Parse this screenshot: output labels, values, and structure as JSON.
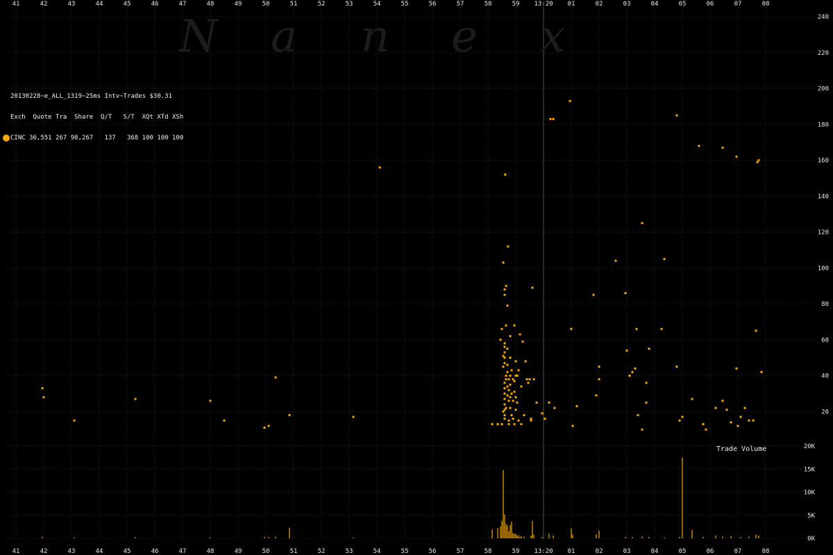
{
  "watermark": "Nanex",
  "header": {
    "title_line": "20130228~e_ALL_1319~25ms Intv~Trades $30.31",
    "columns_line": "Exch  Quote Tra  Share  Q/T   S/T  XQt XTd XSh",
    "data_line": "CINC 36,551 267 98,267   137   368 100 100 100"
  },
  "volume_label": "Trade Volume",
  "colors": {
    "marker": "#f7a800",
    "background": "#000000",
    "grid": "#2a2a2a",
    "text": "#e8e8e8"
  },
  "chart_data": [
    {
      "type": "scatter",
      "title": "",
      "xlabel": "",
      "ylabel": "",
      "x_ticks": [
        "41",
        "42",
        "43",
        "44",
        "45",
        "46",
        "47",
        "48",
        "49",
        "50",
        "51",
        "52",
        "53",
        "54",
        "55",
        "56",
        "57",
        "58",
        "59",
        "13:20",
        "01",
        "02",
        "03",
        "04",
        "05",
        "06",
        "07",
        "08"
      ],
      "ylim": [
        0,
        240
      ],
      "y_ticks": [
        20,
        40,
        60,
        80,
        100,
        120,
        140,
        160,
        180,
        200,
        220,
        240
      ],
      "grid": true,
      "series": [
        {
          "points": [
            [
              41.95,
              33
            ],
            [
              42.0,
              28
            ],
            [
              43.1,
              15
            ],
            [
              45.3,
              27
            ],
            [
              48.0,
              26
            ],
            [
              48.5,
              15
            ],
            [
              49.95,
              11
            ],
            [
              50.1,
              12
            ],
            [
              50.35,
              39
            ],
            [
              50.85,
              18
            ],
            [
              53.15,
              17
            ],
            [
              54.1,
              156
            ],
            [
              58.15,
              13
            ],
            [
              58.35,
              13
            ],
            [
              58.5,
              13
            ],
            [
              58.45,
              60
            ],
            [
              58.5,
              66
            ],
            [
              58.55,
              103
            ],
            [
              58.55,
              51
            ],
            [
              58.55,
              45
            ],
            [
              58.55,
              20
            ],
            [
              58.6,
              88
            ],
            [
              58.6,
              85
            ],
            [
              58.6,
              58
            ],
            [
              58.6,
              56
            ],
            [
              58.6,
              53
            ],
            [
              58.6,
              50
            ],
            [
              58.6,
              47
            ],
            [
              58.6,
              36
            ],
            [
              58.6,
              33
            ],
            [
              58.6,
              30
            ],
            [
              58.6,
              27
            ],
            [
              58.6,
              24
            ],
            [
              58.6,
              21
            ],
            [
              58.6,
              18
            ],
            [
              58.6,
              16
            ],
            [
              58.62,
              152
            ],
            [
              58.65,
              90
            ],
            [
              58.65,
              68
            ],
            [
              58.65,
              40
            ],
            [
              58.65,
              38
            ],
            [
              58.65,
              22
            ],
            [
              58.7,
              79
            ],
            [
              58.7,
              55
            ],
            [
              58.7,
              46
            ],
            [
              58.7,
              42
            ],
            [
              58.7,
              34
            ],
            [
              58.7,
              29
            ],
            [
              58.72,
              112
            ],
            [
              58.75,
              38
            ],
            [
              58.75,
              32
            ],
            [
              58.75,
              26
            ],
            [
              58.75,
              15
            ],
            [
              58.75,
              13
            ],
            [
              58.8,
              62
            ],
            [
              58.8,
              50
            ],
            [
              58.8,
              40
            ],
            [
              58.8,
              35
            ],
            [
              58.8,
              28
            ],
            [
              58.8,
              22
            ],
            [
              58.85,
              43
            ],
            [
              58.85,
              30
            ],
            [
              58.85,
              18
            ],
            [
              58.9,
              38
            ],
            [
              58.9,
              26
            ],
            [
              58.9,
              16
            ],
            [
              58.95,
              68
            ],
            [
              58.95,
              37
            ],
            [
              58.95,
              31
            ],
            [
              58.95,
              13
            ],
            [
              59.0,
              48
            ],
            [
              59.0,
              40
            ],
            [
              59.0,
              28
            ],
            [
              59.0,
              21
            ],
            [
              59.05,
              40
            ],
            [
              59.05,
              25
            ],
            [
              59.1,
              15
            ],
            [
              59.1,
              43
            ],
            [
              59.15,
              63
            ],
            [
              59.2,
              34
            ],
            [
              59.2,
              13
            ],
            [
              59.25,
              59
            ],
            [
              59.3,
              18
            ],
            [
              59.35,
              48
            ],
            [
              59.4,
              38
            ],
            [
              59.45,
              36
            ],
            [
              59.5,
              38
            ],
            [
              59.55,
              16
            ],
            [
              59.55,
              15
            ],
            [
              59.6,
              89
            ],
            [
              59.65,
              38
            ],
            [
              59.75,
              25
            ],
            [
              59.95,
              19
            ],
            [
              60.05,
              16
            ],
            [
              60.2,
              25
            ],
            [
              60.25,
              183
            ],
            [
              60.35,
              183
            ],
            [
              60.4,
              22
            ],
            [
              60.95,
              193
            ],
            [
              61.0,
              66
            ],
            [
              61.05,
              12
            ],
            [
              61.2,
              23
            ],
            [
              61.8,
              85
            ],
            [
              61.9,
              29
            ],
            [
              62.0,
              45
            ],
            [
              62.0,
              38
            ],
            [
              62.6,
              104
            ],
            [
              62.95,
              86
            ],
            [
              63.0,
              54
            ],
            [
              63.1,
              40
            ],
            [
              63.2,
              42
            ],
            [
              63.3,
              44
            ],
            [
              63.35,
              66
            ],
            [
              63.4,
              18
            ],
            [
              63.55,
              125
            ],
            [
              63.55,
              10
            ],
            [
              63.7,
              36
            ],
            [
              63.7,
              25
            ],
            [
              63.8,
              55
            ],
            [
              64.25,
              66
            ],
            [
              64.35,
              105
            ],
            [
              64.8,
              45
            ],
            [
              64.9,
              15
            ],
            [
              65.0,
              17
            ],
            [
              64.8,
              185
            ],
            [
              65.35,
              27
            ],
            [
              65.6,
              168
            ],
            [
              65.75,
              13
            ],
            [
              65.85,
              10
            ],
            [
              66.2,
              22
            ],
            [
              66.45,
              26
            ],
            [
              66.6,
              21
            ],
            [
              66.45,
              167
            ],
            [
              66.75,
              14
            ],
            [
              66.95,
              162
            ],
            [
              66.95,
              44
            ],
            [
              67.0,
              12
            ],
            [
              67.1,
              17
            ],
            [
              67.25,
              22
            ],
            [
              67.4,
              15
            ],
            [
              67.55,
              15
            ],
            [
              67.65,
              65
            ],
            [
              67.7,
              159
            ],
            [
              67.75,
              160
            ],
            [
              67.85,
              42
            ]
          ]
        }
      ]
    },
    {
      "type": "bar",
      "title": "Trade Volume",
      "xlabel": "",
      "ylabel": "",
      "ylim": [
        0,
        20000
      ],
      "y_ticks": [
        "0K",
        "5K",
        "10K",
        "15K",
        "20K"
      ],
      "grid": true,
      "x": [
        41.95,
        43.1,
        45.3,
        48.0,
        49.95,
        50.1,
        50.35,
        50.85,
        53.15,
        58.15,
        58.35,
        58.45,
        58.5,
        58.55,
        58.6,
        58.65,
        58.7,
        58.75,
        58.8,
        58.85,
        58.9,
        58.95,
        59.0,
        59.05,
        59.1,
        59.15,
        59.2,
        59.3,
        59.55,
        59.6,
        59.65,
        59.95,
        60.2,
        60.35,
        61.0,
        61.05,
        61.9,
        62.0,
        62.95,
        63.2,
        63.55,
        63.8,
        64.35,
        64.9,
        65.0,
        65.35,
        65.75,
        66.2,
        66.45,
        66.75,
        67.1,
        67.4,
        67.65,
        67.75
      ],
      "values": [
        300,
        200,
        250,
        200,
        350,
        300,
        400,
        2300,
        200,
        1900,
        2200,
        2600,
        3800,
        14800,
        5200,
        3100,
        2800,
        1500,
        2900,
        3600,
        1200,
        900,
        1000,
        600,
        700,
        300,
        500,
        400,
        600,
        3800,
        800,
        300,
        1000,
        600,
        2200,
        800,
        900,
        1700,
        300,
        300,
        400,
        300,
        200,
        300,
        17500,
        1800,
        300,
        600,
        400,
        500,
        300,
        400,
        800,
        600
      ]
    }
  ]
}
